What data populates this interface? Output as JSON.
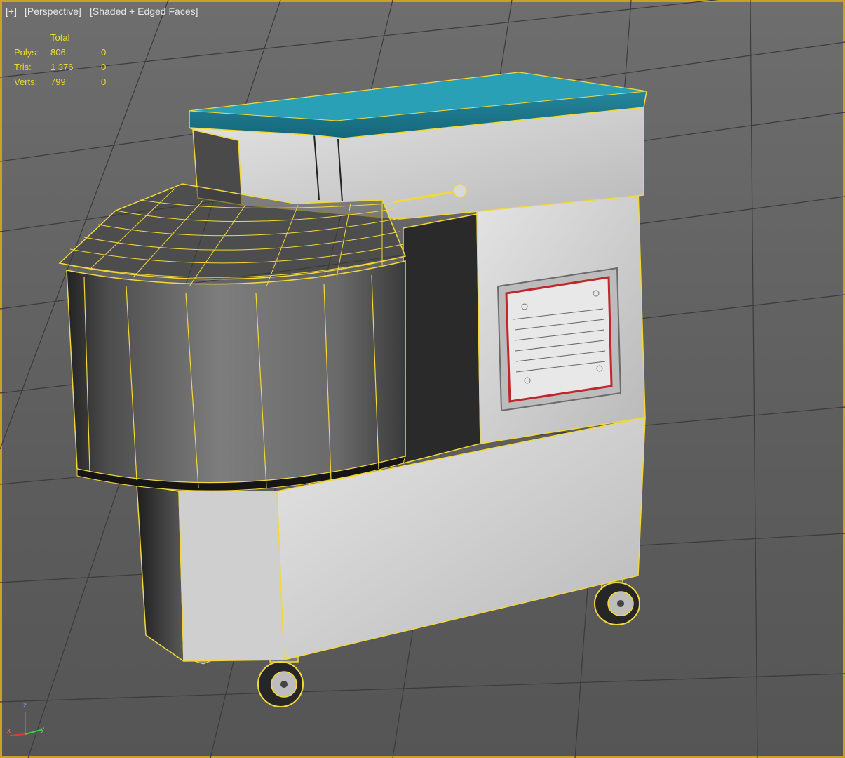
{
  "viewport": {
    "labels": {
      "plus": "[+]",
      "view": "[Perspective]",
      "shading": "[Shaded + Edged Faces]"
    },
    "stats": {
      "header": "Total",
      "rows": [
        {
          "label": "Polys:",
          "total": "806",
          "selected": "0"
        },
        {
          "label": "Tris:",
          "total": "1 376",
          "selected": "0"
        },
        {
          "label": "Verts:",
          "total": "799",
          "selected": "0"
        }
      ]
    },
    "axis_triad": {
      "x": "x",
      "y": "y",
      "z": "z"
    },
    "colors": {
      "active_border": "#c8a224",
      "stats_text": "#e8dc32",
      "selection_wire": "#f2d83a",
      "grid": "#3a3a3a",
      "body": "#cfcfcf",
      "lid": "#1e7f95",
      "plate_border": "#c0272d"
    }
  }
}
